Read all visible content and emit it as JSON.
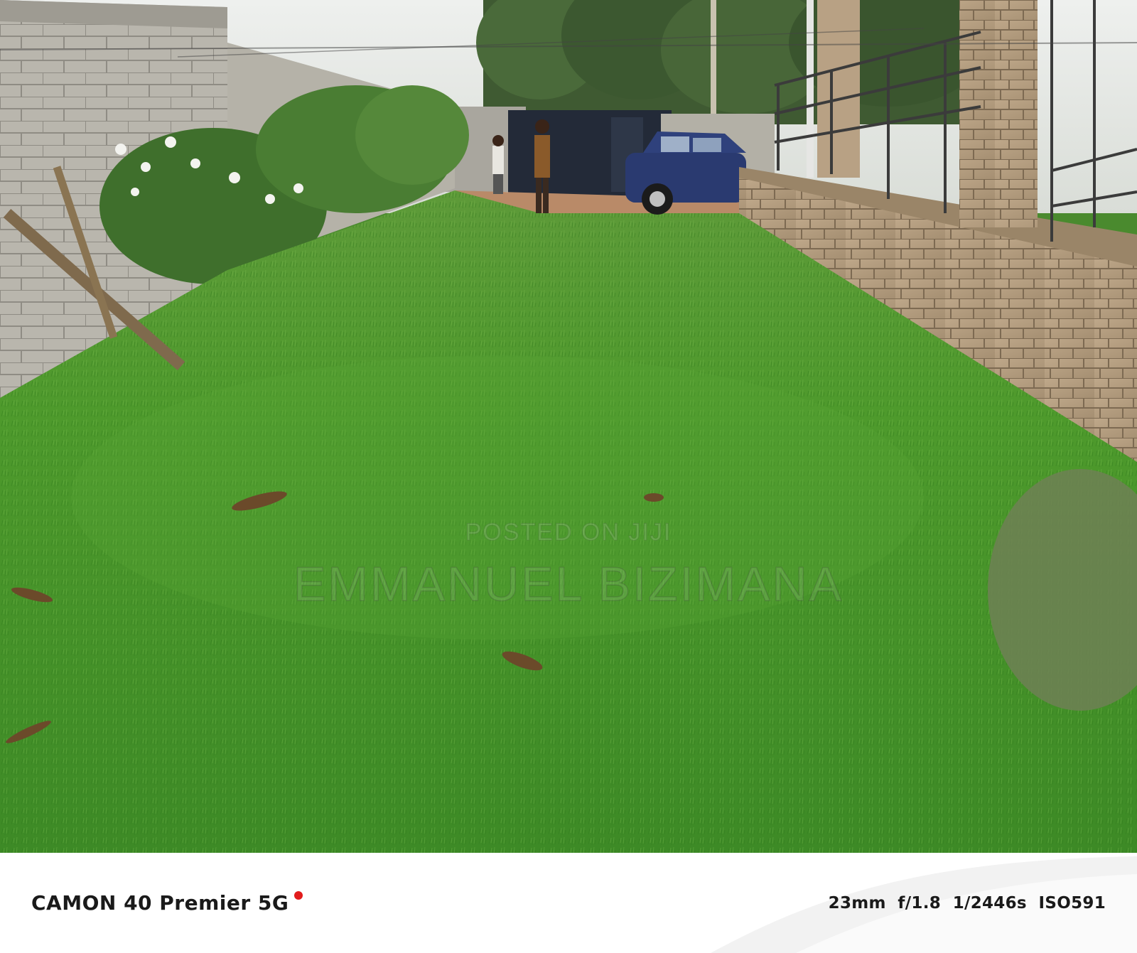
{
  "photo": {
    "watermark_line1": "POSTED ON JIJI",
    "watermark_line2": "EMMANUEL BIZIMANA"
  },
  "camera_bar": {
    "model": "CAMON 40 Premier 5G",
    "exif": "23mm  f/1.8  1/2446s  ISO591",
    "dot_color": "#e21c1c"
  }
}
